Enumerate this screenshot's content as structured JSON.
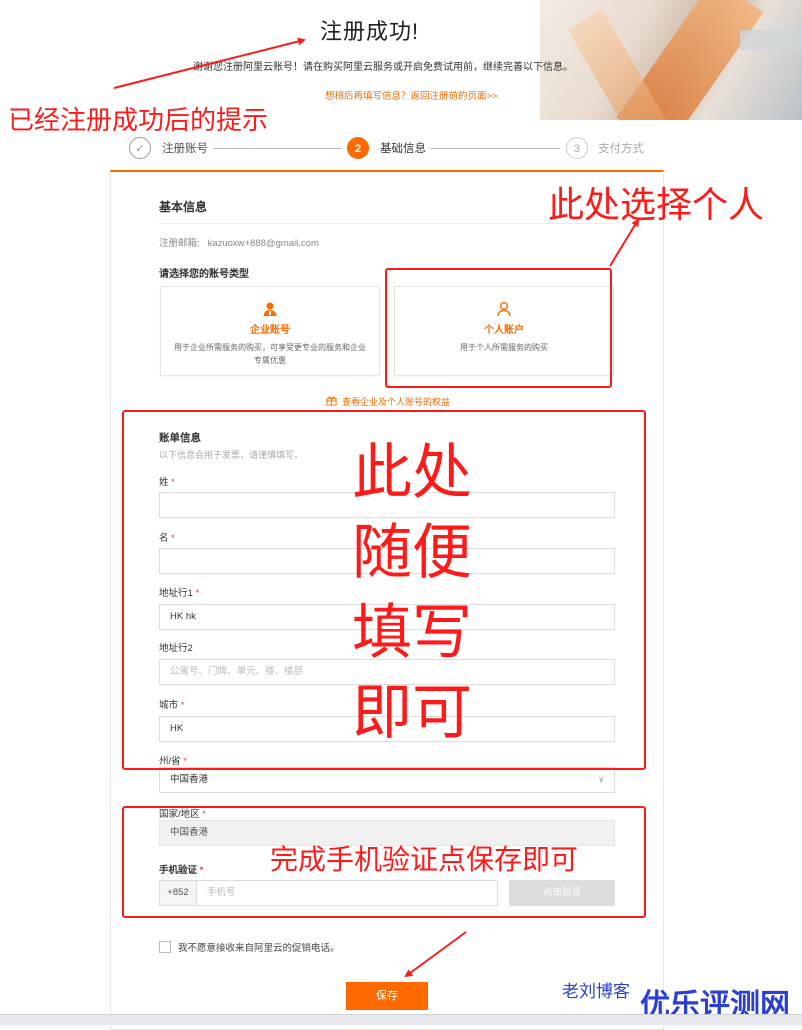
{
  "header": {
    "title": "注册成功!",
    "message": "谢谢您注册阿里云账号！请在购买阿里云服务或开启免费试用前，继续完善以下信息。",
    "fill_later_link": "想稍后再填写信息？返回注册前的页面>>"
  },
  "steps": [
    {
      "number": "✓",
      "label": "注册账号"
    },
    {
      "number": "2",
      "label": "基础信息"
    },
    {
      "number": "3",
      "label": "支付方式"
    }
  ],
  "basic_info": {
    "title": "基本信息",
    "email_label": "注册邮箱:",
    "email_value": "kazuoxw+888@gmail.com",
    "account_type_title": "请选择您的账号类型",
    "enterprise": {
      "name": "企业账号",
      "desc": "用于企业所需服务的购买，可享受更专业的服务和企业专属优惠"
    },
    "personal": {
      "name": "个人账户",
      "desc": "用于个人所需服务的购买"
    },
    "benefits_link": "查看企业及个人账号的权益"
  },
  "billing": {
    "title": "账单信息",
    "hint": "以下信息会用于发票，请谨慎填写。",
    "fields": {
      "last_name": {
        "label": "姓",
        "value": ""
      },
      "first_name": {
        "label": "名",
        "value": ""
      },
      "address1": {
        "label": "地址行1",
        "value": "HK hk"
      },
      "address2": {
        "label": "地址行2",
        "placeholder": "公寓号、门牌、单元、楼、楼层"
      },
      "city": {
        "label": "城市",
        "value": "HK"
      },
      "state": {
        "label": "州/省",
        "value": "中国香港"
      },
      "country": {
        "label": "国家/地区",
        "value": "中国香港"
      },
      "phone": {
        "label": "手机验证",
        "prefix": "+852",
        "placeholder": "手机号",
        "verify_button": "点击验证"
      }
    },
    "required_mark": "*"
  },
  "opt_out_label": "我不愿意接收来自阿里云的促销电话。",
  "save_button": "保存",
  "annotations": {
    "success_hint": "已经注册成功后的提示",
    "choose_personal": "此处选择个人",
    "fill_lines": [
      "此处",
      "随便",
      "填写",
      "即可"
    ],
    "phone_hint": "完成手机验证点保存即可"
  },
  "watermarks": {
    "blog": "老刘博客",
    "site": "优乐评测网"
  },
  "colors": {
    "accent": "#ff6a00",
    "annotation": "#ff1a1a",
    "watermark": "#2b3fd6"
  }
}
